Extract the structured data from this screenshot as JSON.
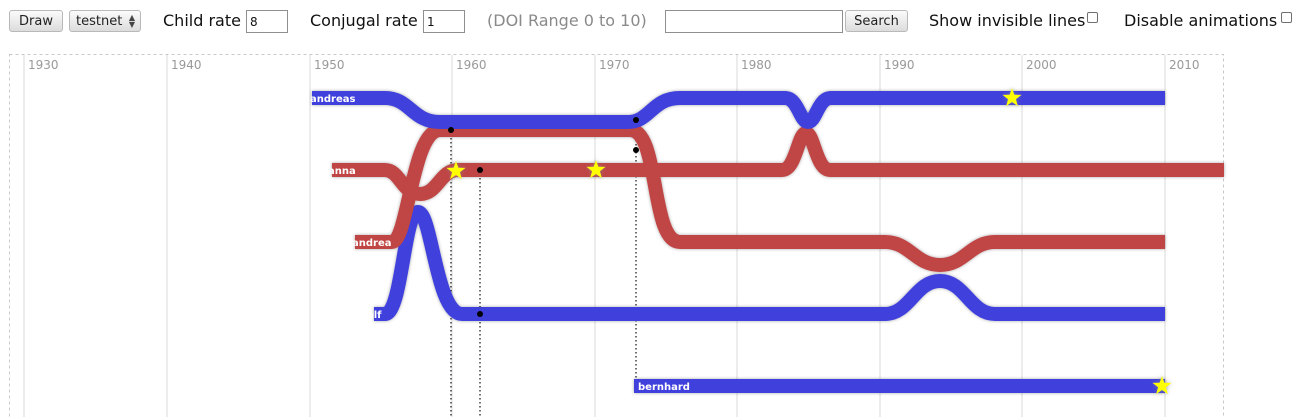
{
  "toolbar": {
    "draw_label": "Draw",
    "dataset_value": "testnet",
    "child_rate_label": "Child rate",
    "child_rate_value": "8",
    "conjugal_rate_label": "Conjugal rate",
    "conjugal_rate_value": "1",
    "doi_range_label": "(DOI Range 0 to 10)",
    "search_value": "",
    "search_label": "Search",
    "show_invisible_label": "Show invisible lines",
    "disable_animations_label": "Disable animations"
  },
  "timeline": {
    "years": [
      "1930",
      "1940",
      "1950",
      "1960",
      "1970",
      "1980",
      "1990",
      "2000",
      "2010"
    ],
    "persons": [
      {
        "name": "andreas",
        "color": "#4040dd"
      },
      {
        "name": "anna",
        "color": "#c04444"
      },
      {
        "name": "andrea",
        "color": "#c04444"
      },
      {
        "name": "alf",
        "color": "#4040dd"
      },
      {
        "name": "bernhard",
        "color": "#4040dd"
      }
    ]
  },
  "colors": {
    "male": "#4040dd",
    "female": "#c04444",
    "event_star": "#ffff00",
    "grid": "#d8d8d8"
  }
}
